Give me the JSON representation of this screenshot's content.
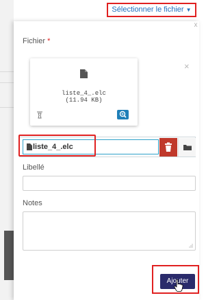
{
  "header": {
    "select_file_label": "Sélectionner le fichier"
  },
  "form": {
    "file_label": "Fichier",
    "required_marker": "*",
    "file_card": {
      "name": "liste_4_.elc",
      "size": "(11.94 KB)",
      "remove": "×"
    },
    "file_input_value": "liste_4_.elc",
    "libelle_label": "Libellé",
    "libelle_value": "",
    "notes_label": "Notes",
    "notes_value": "",
    "submit_label": "Ajouter"
  },
  "panel": {
    "close": "x"
  },
  "colors": {
    "accent": "#1f7fb8",
    "danger": "#c0392b",
    "highlight": "#e02020",
    "submit": "#2a2b6b"
  }
}
